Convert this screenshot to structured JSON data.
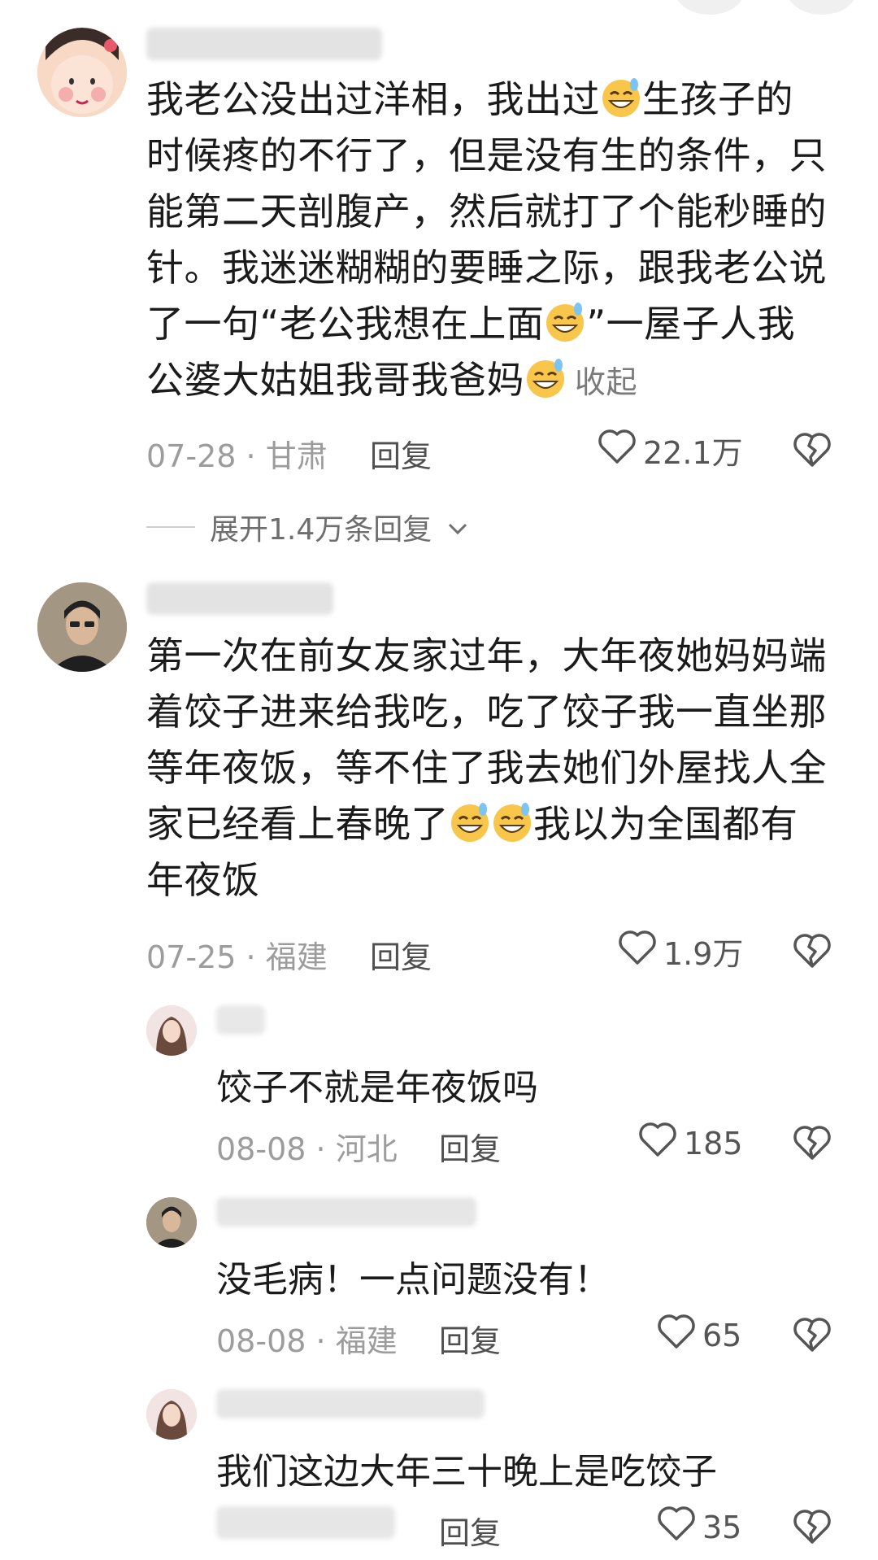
{
  "comments": [
    {
      "segments": [
        "我老公没出过洋相，我出过",
        "生孩子的时候疼的不行了，但是没有生的条件，只能第二天剖腹产，然后就打了个能秒睡的针。我迷迷糊糊的要睡之际，跟我老公说了一句“老公我想在上面",
        "”一屋子人我公婆大姑姐我哥我爸妈"
      ],
      "collapse": "收起",
      "date": "07-28",
      "region": "甘肃",
      "reply": "回复",
      "likes": "22.1万",
      "expand": "展开1.4万条回复"
    },
    {
      "segments": [
        "第一次在前女友家过年，大年夜她妈妈端着饺子进来给我吃，吃了饺子我一直坐那等年夜饭，等不住了我去她们外屋找人全家已经看上春晚了",
        "我以为全国都有年夜饭"
      ],
      "date": "07-25",
      "region": "福建",
      "reply": "回复",
      "likes": "1.9万"
    }
  ],
  "replies": [
    {
      "text": "饺子不就是年夜饭吗",
      "date": "08-08",
      "region": "河北",
      "reply": "回复",
      "likes": "185"
    },
    {
      "text": "没毛病！一点问题没有！",
      "date": "08-08",
      "region": "福建",
      "reply": "回复",
      "likes": "65"
    },
    {
      "text": "我们这边大年三十晚上是吃饺子",
      "reply": "回复",
      "likes": "35"
    }
  ],
  "icons": {
    "like": "heart-outline-icon",
    "dislike": "broken-heart-icon",
    "emoji": "grin-sweat-emoji-icon",
    "expand": "chevron-down-icon"
  },
  "colors": {
    "meta": "#9c9c9c",
    "text": "#1b1b1b",
    "emoji": "#f7c64a"
  }
}
